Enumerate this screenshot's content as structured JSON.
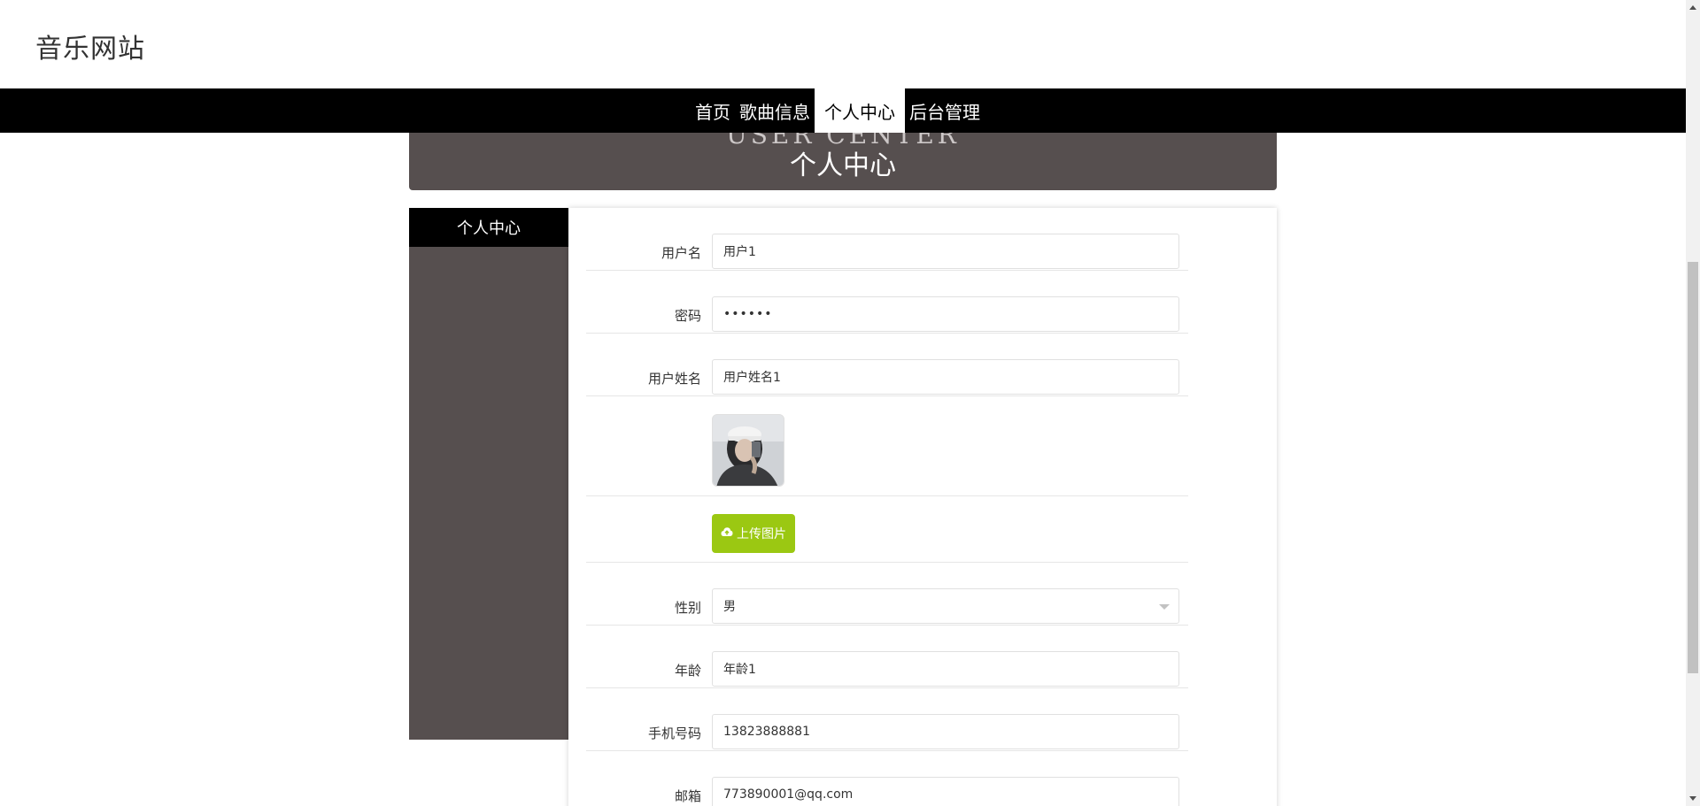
{
  "site": {
    "title": "音乐网站"
  },
  "nav": {
    "items": [
      {
        "label": "首页"
      },
      {
        "label": "歌曲信息"
      },
      {
        "label": "个人中心"
      },
      {
        "label": "后台管理"
      }
    ]
  },
  "banner": {
    "ghost_text": "USER CENTER",
    "title": "个人中心"
  },
  "sidebar": {
    "heading": "个人中心"
  },
  "form": {
    "username": {
      "label": "用户名",
      "value": "用户1"
    },
    "password": {
      "label": "密码",
      "value": "••••••"
    },
    "realname": {
      "label": "用户姓名",
      "value": "用户姓名1"
    },
    "avatar": {
      "icon": "avatar-photo"
    },
    "upload": {
      "label": "上传图片",
      "icon": "cloud-upload-icon"
    },
    "gender": {
      "label": "性别",
      "value": "男"
    },
    "age": {
      "label": "年龄",
      "value": "年龄1"
    },
    "phone": {
      "label": "手机号码",
      "value": "13823888881"
    },
    "email": {
      "label": "邮箱",
      "value": "773890001@qq.com"
    }
  },
  "colors": {
    "nav_bg": "#000000",
    "banner_bg": "#564f4f",
    "sidebar_bg": "#564f4f",
    "upload_button": "#9bc812"
  }
}
